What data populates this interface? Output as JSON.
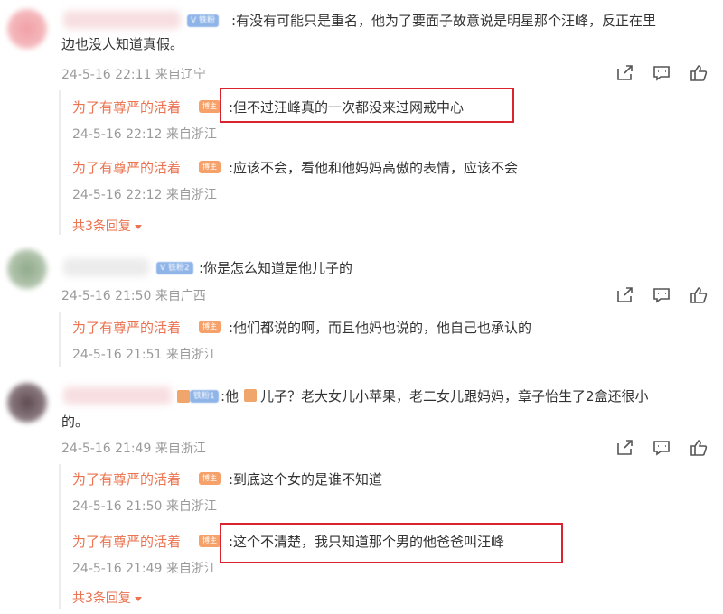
{
  "comments": [
    {
      "badge": "V 铁粉",
      "text_line1": ":有没有可能只是重名，他为了要面子故意说是明星那个汪峰，反正在里",
      "text_line2": "边也没人知道真假。",
      "meta": "24-5-16 22:11 来自辽宁",
      "replies": [
        {
          "name": "为了有尊严的活着",
          "badge": "博主",
          "text": ":但不过汪峰真的一次都没来过网戒中心",
          "meta": "24-5-16 22:12 来自浙江",
          "highlighted": true
        },
        {
          "name": "为了有尊严的活着",
          "badge": "博主",
          "text": ":应该不会，看他和他妈妈高傲的表情，应该不会",
          "meta": "24-5-16 22:12 来自浙江",
          "highlighted": false
        }
      ],
      "more_replies": "共3条回复"
    },
    {
      "badge": "V 铁粉2",
      "text_line1": ":你是怎么知道是他儿子的",
      "meta": "24-5-16 21:50 来自广西",
      "replies": [
        {
          "name": "为了有尊严的活着",
          "badge": "博主",
          "text": ":他们都说的啊，而且他妈也说的，他自己也承认的",
          "meta": "24-5-16 21:51 来自浙江",
          "highlighted": false
        }
      ]
    },
    {
      "badge": "铁粉1",
      "text_prefix": ":他",
      "text_line1": "儿子？老大女儿小苹果，老二女儿跟妈妈，章子怡生了2盒还很小",
      "text_line2": "的。",
      "meta": "24-5-16 21:49 来自浙江",
      "replies": [
        {
          "name": "为了有尊严的活着",
          "badge": "博主",
          "text": ":到底这个女的是谁不知道",
          "meta": "24-5-16 21:50 来自浙江",
          "highlighted": false
        },
        {
          "name": "为了有尊严的活着",
          "badge": "博主",
          "text": ":这个不清楚，我只知道那个男的他爸爸叫汪峰",
          "meta": "24-5-16 21:49 来自浙江",
          "highlighted": true
        }
      ],
      "more_replies": "共3条回复"
    }
  ],
  "icons": [
    "share-icon",
    "comment-icon",
    "like-icon"
  ],
  "colors": {
    "reply_name": "#eb7350",
    "highlight": "#d9232e",
    "meta": "#9a9a9a"
  }
}
